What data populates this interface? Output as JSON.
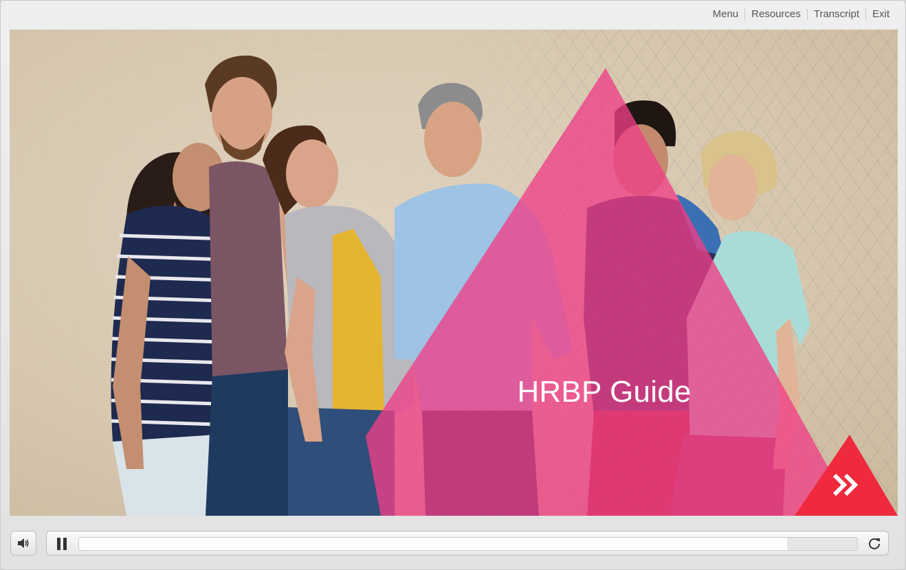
{
  "menu": {
    "items": [
      {
        "label": "Menu"
      },
      {
        "label": "Resources"
      },
      {
        "label": "Transcript"
      },
      {
        "label": "Exit"
      }
    ]
  },
  "slide": {
    "title": "HRBP Guide",
    "accent_color": "#f0468a",
    "next_button_color": "#ee2a3c"
  },
  "icons": {
    "volume": "speaker-icon",
    "pause": "pause-icon",
    "replay": "replay-icon",
    "next": "double-chevron-right-icon"
  },
  "playback": {
    "progress_fraction": 0.91
  }
}
